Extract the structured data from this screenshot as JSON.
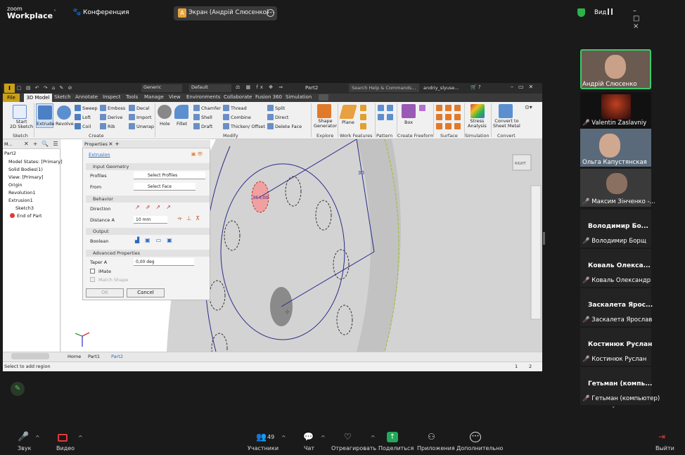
{
  "zoom": {
    "logo_line1": "zoom",
    "logo_line2": "Workplace",
    "meeting": "Конференция",
    "share_badge": "A",
    "share_title": "Экран (Андрій Слюсенко)",
    "view_label": "Вид",
    "window_controls": "– □ ×",
    "chevron": "˅"
  },
  "inventor": {
    "part_title": "Part2",
    "search": "Search Help & Commands...",
    "user": "andriy_slyuse...",
    "qat": {
      "material": "Generic",
      "appearance": "Default"
    },
    "tabs": [
      "File",
      "3D Model",
      "Sketch",
      "Annotate",
      "Inspect",
      "Tools",
      "Manage",
      "View",
      "Environments",
      "Collaborate",
      "Fusion 360",
      "Simulation"
    ],
    "ribbon": {
      "start_sketch": "Start\n2D Sketch",
      "extrude": "Extrude",
      "revolve": "Revolve",
      "create_items": [
        "Sweep",
        "Loft",
        "Coil",
        "Emboss",
        "Derive",
        "Rib",
        "Decal",
        "Import",
        "Unwrap"
      ],
      "hole": "Hole",
      "fillet": "Fillet",
      "modify_items": [
        "Chamfer",
        "Shell",
        "Draft",
        "Thread",
        "Combine",
        "Thicken/ Offset",
        "Split",
        "Direct",
        "Delete Face"
      ],
      "shape_generator": "Shape\nGenerator",
      "plane": "Plane",
      "box": "Box",
      "stress": "Stress\nAnalysis",
      "convert": "Convert to\nSheet Metal",
      "groups": [
        "Sketch",
        "Create",
        "Modify",
        "Explore",
        "Work Features",
        "Pattern",
        "Create Freeform",
        "Surface",
        "Simulation",
        "Convert"
      ]
    },
    "browser": {
      "header": "M...",
      "items": [
        "Part2",
        "Model States: [Primary]",
        "Solid Bodies(1)",
        "View: [Primary]",
        "Origin",
        "Revolution1",
        "Extrusion1",
        "Sketch3",
        "End of Part"
      ]
    },
    "properties": {
      "title": "Properties",
      "feature": "Extrusion",
      "input_geometry": "Input Geometry",
      "profiles_label": "Profiles",
      "profiles_value": "Select Profiles",
      "from_label": "From",
      "from_value": "Select Face",
      "behavior": "Behavior",
      "direction_label": "Direction",
      "distance_label": "Distance A",
      "distance_value": "10 mm",
      "output": "Output",
      "boolean_label": "Boolean",
      "advanced": "Advanced Properties",
      "taper_label": "Taper A",
      "taper_value": "0,00 deg",
      "imate": "iMate",
      "match_shape": "Match Shape",
      "ok": "OK",
      "cancel": "Cancel"
    },
    "viewport": {
      "dim_label": "30",
      "hole_label": "364,00",
      "cube_label": "RIGHT"
    },
    "bottom_tabs": [
      "Home",
      "Part1",
      "Part2"
    ],
    "status": {
      "text": "Select to add region",
      "count1": "1",
      "count2": "2"
    }
  },
  "participants": [
    {
      "name": "Андрій Слюсенко",
      "muted": false
    },
    {
      "name": "Valentin Zaslavniy",
      "muted": true
    },
    {
      "name": "Ольга Капустянская",
      "muted": false
    },
    {
      "name": "Максим Зінченко -...",
      "muted": true
    },
    {
      "big": "Володимир  Бо...",
      "name": "Володимир Борщ",
      "muted": true
    },
    {
      "big": "Коваль  Олекса...",
      "name": "Коваль Олександр",
      "muted": true
    },
    {
      "big": "Заскалета  Ярос...",
      "name": "Заскалета Ярослав",
      "muted": true
    },
    {
      "big": "Костинюк Руслан",
      "name": "Костинюк Руслан",
      "muted": true
    },
    {
      "big": "Гетьман  (компь...",
      "name": "Гетьман (компьютер)",
      "muted": true
    }
  ],
  "toolbar": {
    "audio": "Звук",
    "video": "Видео",
    "participants": "Участники",
    "participants_count": "49",
    "chat": "Чат",
    "react": "Отреагировать",
    "share": "Поделиться",
    "apps": "Приложения",
    "more": "Дополнительно",
    "leave": "Выйти"
  },
  "colors": {
    "zoom_bg": "#1a1a1a",
    "share_green": "#21a85a",
    "inventor_gold": "#c9a01b",
    "muted_red": "#e03a3a",
    "active_border": "#3ccc6a"
  }
}
